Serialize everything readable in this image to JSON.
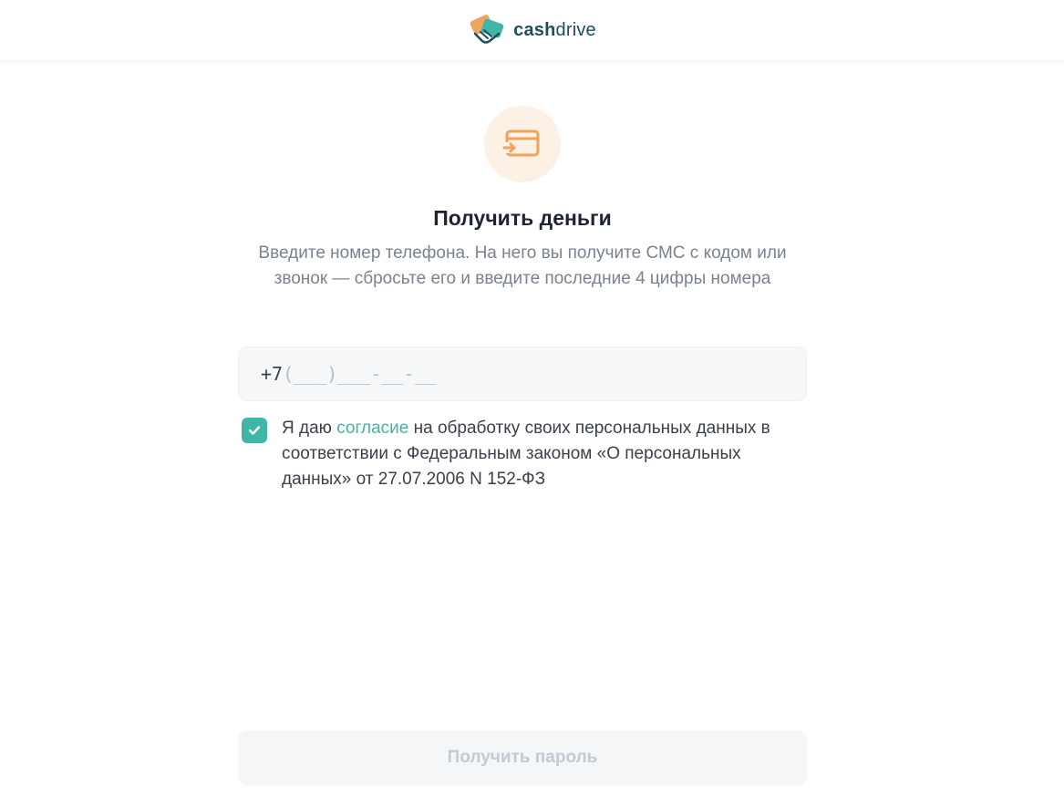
{
  "brand": {
    "name_bold": "cash",
    "name_light": "drive",
    "logo_icon": "handshake-card-icon",
    "text_color": "#1e4d5c",
    "accent_teal": "#3fb6a6",
    "accent_orange": "#f0a35a"
  },
  "hero": {
    "icon": "card-transfer-icon",
    "title": "Получить деньги",
    "subtitle": "Введите номер телефона. На него вы получите СМС с кодом или звонок — сбросьте его и введите последние 4 цифры номера"
  },
  "phone": {
    "prefix": "+7",
    "mask": "(___)___-__-__"
  },
  "consent": {
    "checked": true,
    "text_before": "Я даю ",
    "link_text": "согласие",
    "text_after": " на обработку своих персональных данных в соответствии с Федеральным законом «О персональных данных» от 27.07.2006 N 152-ФЗ",
    "check_icon": "checkmark-icon"
  },
  "submit": {
    "label": "Получить пароль",
    "disabled": true
  }
}
